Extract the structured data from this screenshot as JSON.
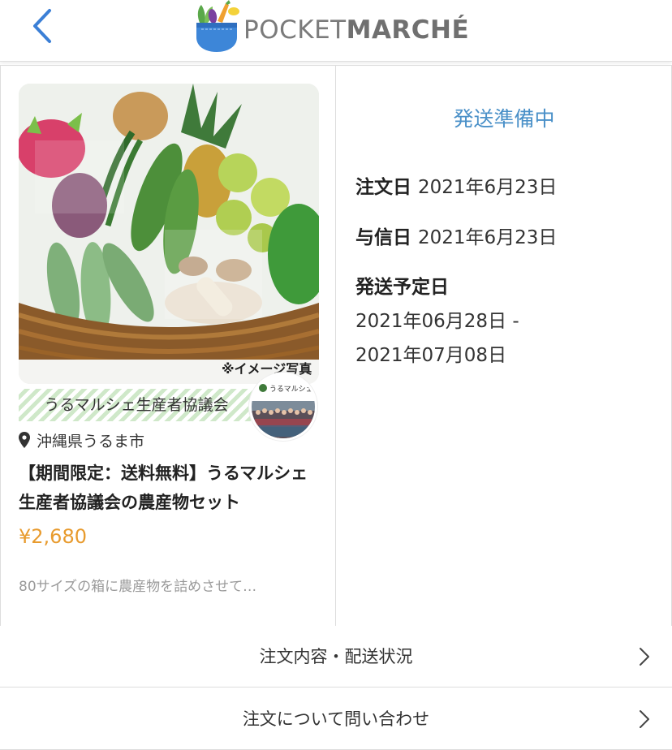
{
  "header": {
    "back_icon": "chevron-left-icon",
    "logo_light": "POCKET",
    "logo_bold": "MARCHÉ",
    "accent_color": "#3b7fd6"
  },
  "product": {
    "image_caption": "※イメージ写真",
    "producer_name": "うるマルシェ生産者協議会",
    "avatar_label": "うるマルシェ",
    "location_icon": "map-pin-icon",
    "location": "沖縄県うるま市",
    "title": "【期間限定：送料無料】うるマルシェ生産者協議会の農産物セット",
    "price": "¥2,680",
    "price_color": "#e89b2e",
    "description": "80サイズの箱に農産物を詰めさせて…"
  },
  "order": {
    "status": "発送準備中",
    "status_color": "#4a90c8",
    "order_date_label": "注文日",
    "order_date": "2021年6月23日",
    "credit_date_label": "与信日",
    "credit_date": "2021年6月23日",
    "ship_label": "発送予定日",
    "ship_start": "2021年06月28日 -",
    "ship_end": "2021年07月08日"
  },
  "menu": {
    "items": [
      {
        "label": "注文内容・配送状況",
        "icon": "chevron-right-icon"
      },
      {
        "label": "注文について問い合わせ",
        "icon": "chevron-right-icon"
      }
    ]
  }
}
